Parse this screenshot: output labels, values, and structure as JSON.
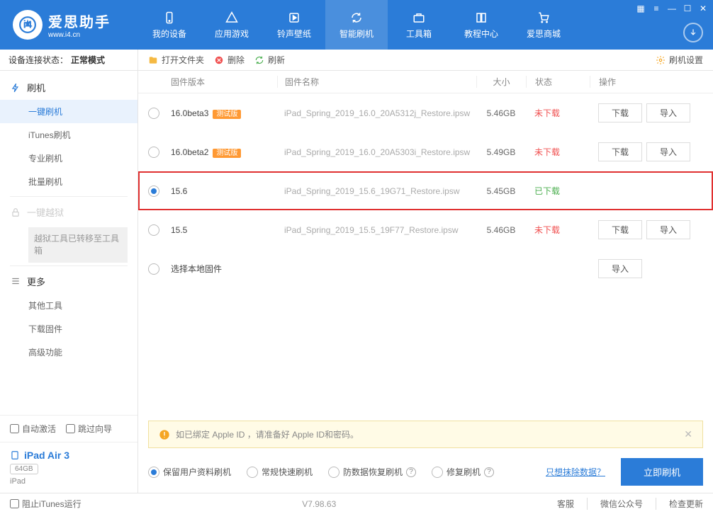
{
  "app": {
    "title": "爱思助手",
    "sub": "www.i4.cn"
  },
  "nav": [
    "我的设备",
    "应用游戏",
    "铃声壁纸",
    "智能刷机",
    "工具箱",
    "教程中心",
    "爱思商城"
  ],
  "status": {
    "label": "设备连接状态：",
    "value": "正常模式"
  },
  "sidebar": {
    "flash": "刷机",
    "items": [
      "一键刷机",
      "iTunes刷机",
      "专业刷机",
      "批量刷机"
    ],
    "jailbreak": "一键越狱",
    "jailbreak_notice": "越狱工具已转移至工具箱",
    "more": "更多",
    "more_items": [
      "其他工具",
      "下载固件",
      "高级功能"
    ],
    "chk1": "自动激活",
    "chk2": "跳过向导",
    "device": {
      "name": "iPad Air 3",
      "storage": "64GB",
      "type": "iPad"
    }
  },
  "toolbar": {
    "open": "打开文件夹",
    "delete": "删除",
    "refresh": "刷新",
    "settings": "刷机设置"
  },
  "columns": {
    "ver": "固件版本",
    "name": "固件名称",
    "size": "大小",
    "status": "状态",
    "ops": "操作"
  },
  "rows": [
    {
      "ver": "16.0beta3",
      "badge": "测试版",
      "name": "iPad_Spring_2019_16.0_20A5312j_Restore.ipsw",
      "size": "5.46GB",
      "status": "未下载",
      "downloaded": false,
      "selected": false
    },
    {
      "ver": "16.0beta2",
      "badge": "测试版",
      "name": "iPad_Spring_2019_16.0_20A5303i_Restore.ipsw",
      "size": "5.49GB",
      "status": "未下载",
      "downloaded": false,
      "selected": false
    },
    {
      "ver": "15.6",
      "badge": "",
      "name": "iPad_Spring_2019_15.6_19G71_Restore.ipsw",
      "size": "5.45GB",
      "status": "已下载",
      "downloaded": true,
      "selected": true
    },
    {
      "ver": "15.5",
      "badge": "",
      "name": "iPad_Spring_2019_15.5_19F77_Restore.ipsw",
      "size": "5.46GB",
      "status": "未下载",
      "downloaded": false,
      "selected": false
    }
  ],
  "local_row": "选择本地固件",
  "ops": {
    "download": "下载",
    "import": "导入"
  },
  "warn": "如已绑定 Apple ID ，请准备好 Apple ID和密码。",
  "options": [
    "保留用户资料刷机",
    "常规快速刷机",
    "防数据恢复刷机",
    "修复刷机"
  ],
  "erase_link": "只想抹除数据？",
  "main_btn": "立即刷机",
  "footer": {
    "stop": "阻止iTunes运行",
    "ver": "V7.98.63",
    "links": [
      "客服",
      "微信公众号",
      "检查更新"
    ]
  }
}
